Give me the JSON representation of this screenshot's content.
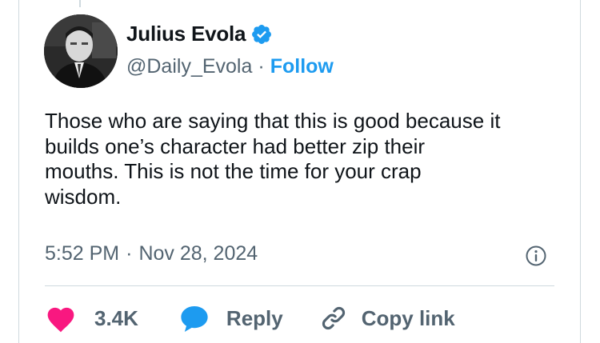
{
  "author": {
    "name": "Julius Evola",
    "handle": "@Daily_Evola",
    "separator": "·",
    "follow_label": "Follow",
    "avatar_icon": "portrait-avatar",
    "verified_icon": "verified-badge-icon"
  },
  "tweet": {
    "text": "Those who are saying that this is good because it\nbuilds one’s character had better zip their\nmouths. This is not the time for your crap\nwisdom."
  },
  "meta": {
    "time": "5:52 PM",
    "separator": "·",
    "date": "Nov 28, 2024",
    "info_icon": "info-icon"
  },
  "actions": {
    "like_count": "3.4K",
    "reply_label": "Reply",
    "copy_label": "Copy link"
  },
  "colors": {
    "accent": "#1d9bf0",
    "like": "#f91880",
    "text": "#0f1419",
    "muted": "#536471",
    "border": "#cfd9de"
  }
}
